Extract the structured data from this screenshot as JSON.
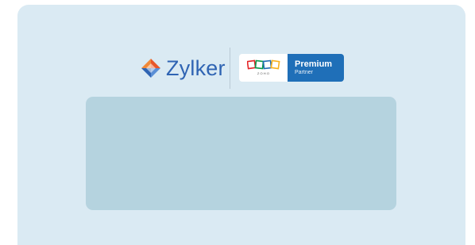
{
  "brand": {
    "name": "Zylker",
    "icon": "zylker-logo-icon",
    "color": "#2f64b3"
  },
  "partner_badge": {
    "logo": "zoho-logo-icon",
    "logo_caption": "ZOHO",
    "tier": "Premium",
    "label": "Partner",
    "color": "#1f6fb8"
  },
  "colors": {
    "card_background": "#daeaf3",
    "placeholder_background": "#b5d3df"
  }
}
